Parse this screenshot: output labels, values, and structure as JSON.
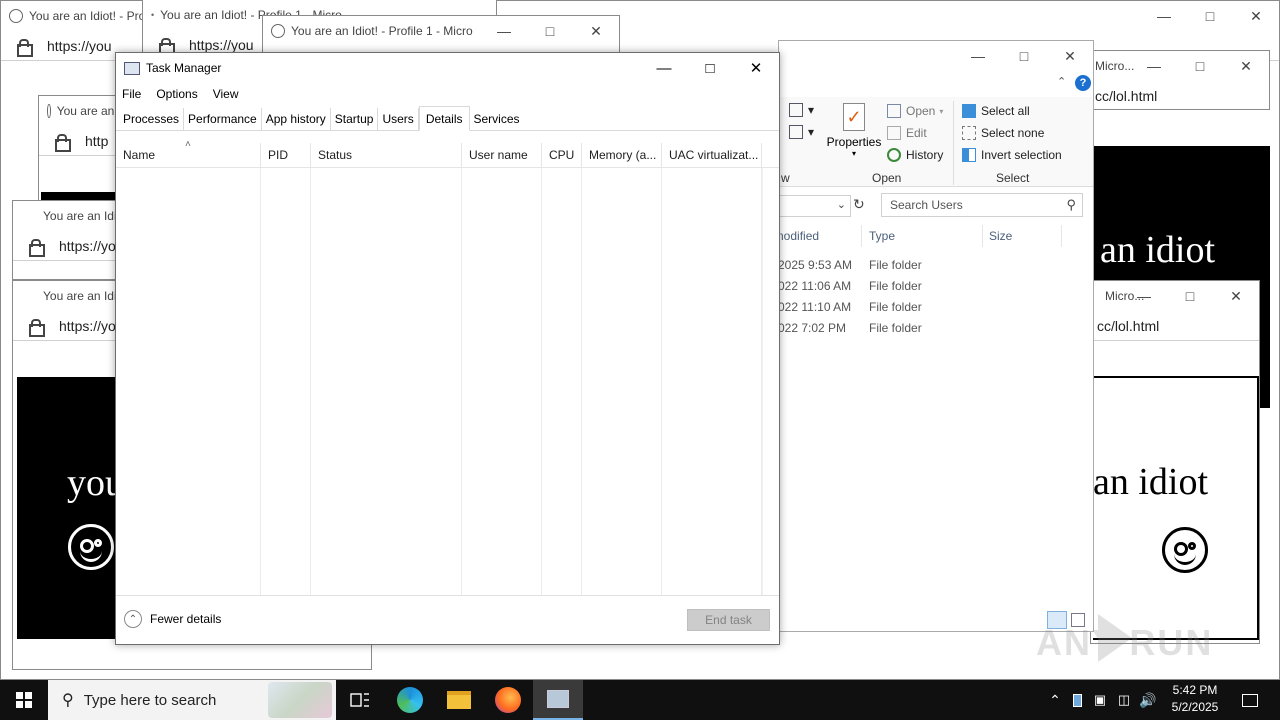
{
  "bg_windows": {
    "title_text": "You are an Idiot! - Profile 1 - Micro",
    "title_short": "You are an Idiot! - Pro",
    "title_idiot": "You are an Idio",
    "title_micro": "Micro...",
    "url_short": "https://yo",
    "url_short2": "https://you",
    "url_short3": "http",
    "url_tail": "cc/lol.html",
    "page_text_you": "you",
    "page_text_idiot": "an idiot"
  },
  "task_manager": {
    "title": "Task Manager",
    "menu": [
      "File",
      "Options",
      "View"
    ],
    "tabs": [
      "Processes",
      "Performance",
      "App history",
      "Startup",
      "Users",
      "Details",
      "Services"
    ],
    "active_tab": "Details",
    "columns": [
      "Name",
      "PID",
      "Status",
      "User name",
      "CPU",
      "Memory (a...",
      "UAC virtualizat..."
    ],
    "fewer_details": "Fewer details",
    "end_task": "End task"
  },
  "explorer": {
    "ribbon": {
      "properties": "Properties",
      "open": "Open",
      "edit": "Edit",
      "history": "History",
      "select_all": "Select all",
      "select_none": "Select none",
      "invert_selection": "Invert selection",
      "group_open": "Open",
      "group_select": "Select",
      "group_partial": "w"
    },
    "search_placeholder": "Search Users",
    "headers": [
      "nodified",
      "Type",
      "Size"
    ],
    "rows": [
      {
        "modified": "2025 9:53 AM",
        "type": "File folder"
      },
      {
        "modified": "022 11:06 AM",
        "type": "File folder"
      },
      {
        "modified": "022 11:10 AM",
        "type": "File folder"
      },
      {
        "modified": "022 7:02 PM",
        "type": "File folder"
      }
    ]
  },
  "taskbar": {
    "search_placeholder": "Type here to search",
    "time": "5:42 PM",
    "date": "5/2/2025"
  },
  "watermark": "ANY RUN",
  "colors": {
    "taskbar": "#101010",
    "desktop": "#0078d7",
    "accent": "#0078d7"
  }
}
